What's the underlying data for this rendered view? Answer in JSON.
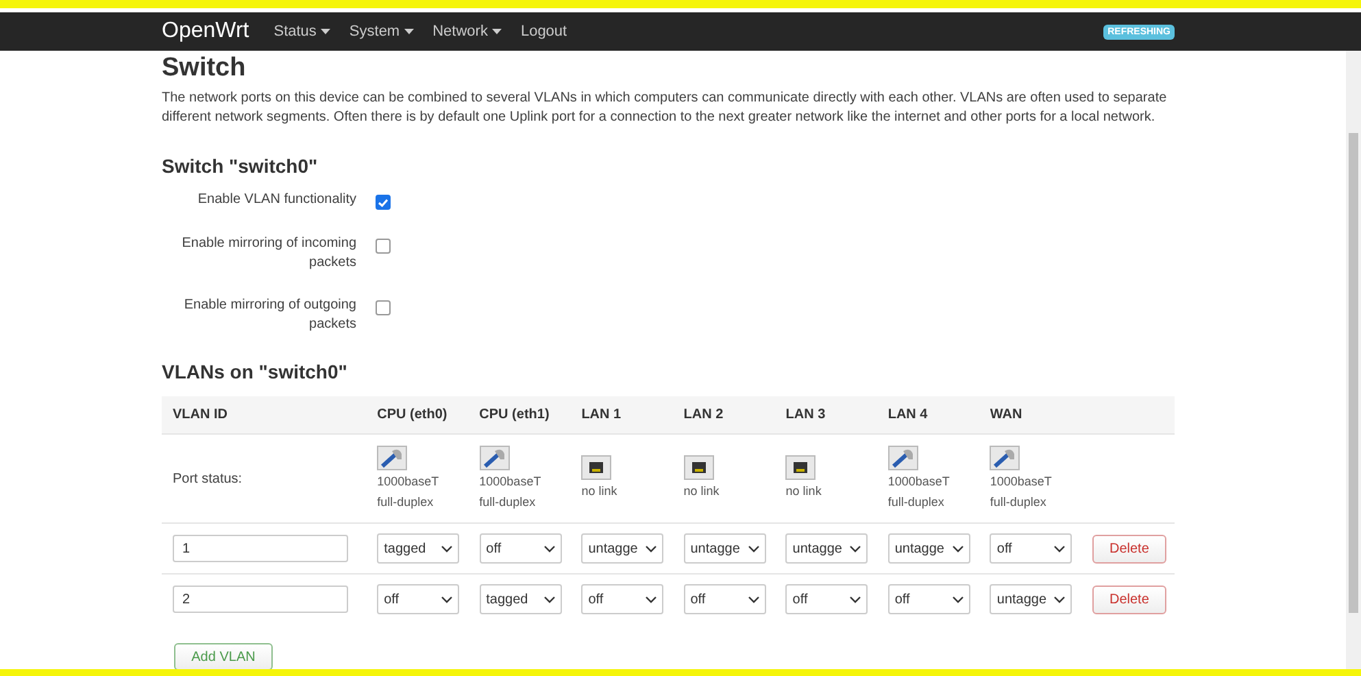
{
  "navbar": {
    "brand": "OpenWrt",
    "menu": [
      {
        "label": "Status",
        "dropdown": true
      },
      {
        "label": "System",
        "dropdown": true
      },
      {
        "label": "Network",
        "dropdown": true
      },
      {
        "label": "Logout",
        "dropdown": false
      }
    ],
    "badge": "REFRESHING"
  },
  "page": {
    "title": "Switch",
    "description": "The network ports on this device can be combined to several VLANs in which computers can communicate directly with each other. VLANs are often used to separate different network segments. Often there is by default one Uplink port for a connection to the next greater network like the internet and other ports for a local network."
  },
  "switch": {
    "title": "Switch \"switch0\"",
    "options": [
      {
        "label": "Enable VLAN functionality",
        "checked": true
      },
      {
        "label": "Enable mirroring of incoming packets",
        "checked": false
      },
      {
        "label": "Enable mirroring of outgoing packets",
        "checked": false
      }
    ]
  },
  "vlans": {
    "title": "VLANs on \"switch0\"",
    "columns": [
      "VLAN ID",
      "CPU (eth0)",
      "CPU (eth1)",
      "LAN 1",
      "LAN 2",
      "LAN 3",
      "LAN 4",
      "WAN"
    ],
    "port_status_label": "Port status:",
    "ports": [
      {
        "kind": "linked",
        "lines": [
          "1000baseT",
          "full-duplex"
        ]
      },
      {
        "kind": "linked",
        "lines": [
          "1000baseT",
          "full-duplex"
        ]
      },
      {
        "kind": "nolink",
        "lines": [
          "no link"
        ]
      },
      {
        "kind": "nolink",
        "lines": [
          "no link"
        ]
      },
      {
        "kind": "nolink",
        "lines": [
          "no link"
        ]
      },
      {
        "kind": "linked",
        "lines": [
          "1000baseT",
          "full-duplex"
        ]
      },
      {
        "kind": "linked",
        "lines": [
          "1000baseT",
          "full-duplex"
        ]
      }
    ],
    "rows": [
      {
        "id": "1",
        "ports": [
          "tagged",
          "off",
          "untagge",
          "untagge",
          "untagge",
          "untagge",
          "off"
        ],
        "delete": "Delete"
      },
      {
        "id": "2",
        "ports": [
          "off",
          "tagged",
          "off",
          "off",
          "off",
          "off",
          "untagge"
        ],
        "delete": "Delete"
      }
    ],
    "add_button": "Add VLAN"
  }
}
